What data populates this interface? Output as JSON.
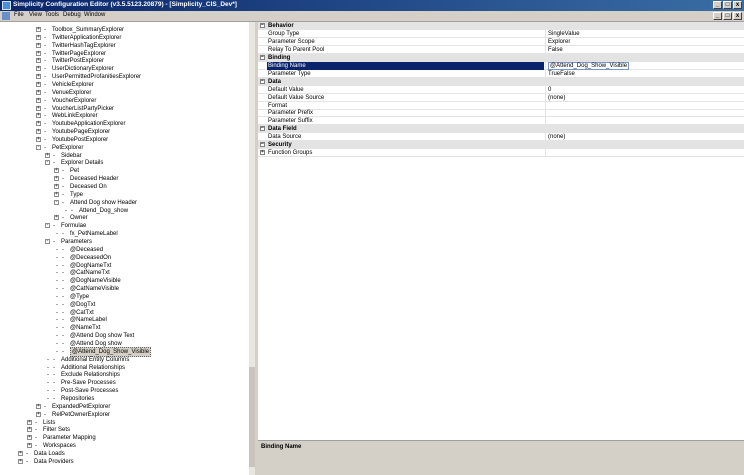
{
  "window": {
    "title": "Simplicity Configuration Editor (v3.5.5123.20879) - [Simplicity_CIS_Dev*]",
    "buttons": [
      "_",
      "□",
      "x"
    ]
  },
  "menu": [
    "File",
    "View",
    "Tools",
    "Debug",
    "Window"
  ],
  "tree": [
    {
      "label": "Toolbox_SummaryExplorer",
      "indent": 0,
      "exp": "+"
    },
    {
      "label": "TwitterApplicationExplorer",
      "indent": 0,
      "exp": "+"
    },
    {
      "label": "TwitterHashTagExplorer",
      "indent": 0,
      "exp": "+"
    },
    {
      "label": "TwitterPageExplorer",
      "indent": 0,
      "exp": "+"
    },
    {
      "label": "TwitterPostExplorer",
      "indent": 0,
      "exp": "+"
    },
    {
      "label": "UserDictionaryExplorer",
      "indent": 0,
      "exp": "+"
    },
    {
      "label": "UserPermittedProfanitiesExplorer",
      "indent": 0,
      "exp": "+"
    },
    {
      "label": "VehicleExplorer",
      "indent": 0,
      "exp": "+"
    },
    {
      "label": "VenueExplorer",
      "indent": 0,
      "exp": "+"
    },
    {
      "label": "VoucherExplorer",
      "indent": 0,
      "exp": "+"
    },
    {
      "label": "VoucherListPartyPicker",
      "indent": 0,
      "exp": "+"
    },
    {
      "label": "WebLinkExplorer",
      "indent": 0,
      "exp": "+"
    },
    {
      "label": "YoutubeApplicationExplorer",
      "indent": 0,
      "exp": "+"
    },
    {
      "label": "YoutubePageExplorer",
      "indent": 0,
      "exp": "+"
    },
    {
      "label": "YoutubePostExplorer",
      "indent": 0,
      "exp": "+"
    },
    {
      "label": "PetExplorer",
      "indent": 0,
      "exp": "-"
    },
    {
      "label": "Sidebar",
      "indent": 1,
      "exp": "+"
    },
    {
      "label": "Explorer Details",
      "indent": 1,
      "exp": "-"
    },
    {
      "label": "Pet",
      "indent": 2,
      "exp": "+"
    },
    {
      "label": "Deceased Header",
      "indent": 2,
      "exp": "+"
    },
    {
      "label": "Deceased On",
      "indent": 2,
      "exp": "+"
    },
    {
      "label": "Type",
      "indent": 2,
      "exp": "+"
    },
    {
      "label": "Attend Dog show Header",
      "indent": 2,
      "exp": "-"
    },
    {
      "label": "Attend_Dog_show",
      "indent": 3,
      "exp": ""
    },
    {
      "label": "Owner",
      "indent": 2,
      "exp": "+"
    },
    {
      "label": "Formulae",
      "indent": 1,
      "exp": "-"
    },
    {
      "label": "fx_PetNameLabel",
      "indent": 2,
      "exp": ""
    },
    {
      "label": "Parameters",
      "indent": 1,
      "exp": "-"
    },
    {
      "label": "@Deceased",
      "indent": 2,
      "exp": ""
    },
    {
      "label": "@DeceasedOn",
      "indent": 2,
      "exp": ""
    },
    {
      "label": "@DogNameTxt",
      "indent": 2,
      "exp": ""
    },
    {
      "label": "@CatNameTxt",
      "indent": 2,
      "exp": ""
    },
    {
      "label": "@DogNameVisible",
      "indent": 2,
      "exp": ""
    },
    {
      "label": "@CatNameVisible",
      "indent": 2,
      "exp": ""
    },
    {
      "label": "@Type",
      "indent": 2,
      "exp": ""
    },
    {
      "label": "@DogTxt",
      "indent": 2,
      "exp": ""
    },
    {
      "label": "@CatTxt",
      "indent": 2,
      "exp": ""
    },
    {
      "label": "@NameLabel",
      "indent": 2,
      "exp": ""
    },
    {
      "label": "@NameTxt",
      "indent": 2,
      "exp": ""
    },
    {
      "label": "@Attend Dog show Text",
      "indent": 2,
      "exp": ""
    },
    {
      "label": "@Attend Dog show",
      "indent": 2,
      "exp": ""
    },
    {
      "label": "@Attend_Dog_Show_Visible",
      "indent": 2,
      "exp": "",
      "selected": true
    },
    {
      "label": "Additional Entity Columns",
      "indent": 1,
      "exp": ""
    },
    {
      "label": "Additional Relationships",
      "indent": 1,
      "exp": ""
    },
    {
      "label": "Exclude Relationships",
      "indent": 1,
      "exp": ""
    },
    {
      "label": "Pre-Save Processes",
      "indent": 1,
      "exp": ""
    },
    {
      "label": "Post-Save Processes",
      "indent": 1,
      "exp": ""
    },
    {
      "label": "Repositories",
      "indent": 1,
      "exp": ""
    },
    {
      "label": "ExpandedPetExplorer",
      "indent": 0,
      "exp": "+"
    },
    {
      "label": "RelPetOwnerExplorer",
      "indent": 0,
      "exp": "+"
    },
    {
      "label": "Lists",
      "indent": -1,
      "exp": "+"
    },
    {
      "label": "Filter Sets",
      "indent": -1,
      "exp": "+"
    },
    {
      "label": "Parameter Mapping",
      "indent": -1,
      "exp": "+"
    },
    {
      "label": "Workspaces",
      "indent": -1,
      "exp": "+"
    },
    {
      "label": "Data Loads",
      "indent": -2,
      "exp": "+"
    },
    {
      "label": "Data Providers",
      "indent": -2,
      "exp": "+"
    }
  ],
  "properties": [
    {
      "type": "cat",
      "name": "Behavior"
    },
    {
      "type": "prop",
      "name": "Group Type",
      "value": "SingleValue"
    },
    {
      "type": "prop",
      "name": "Parameter Scope",
      "value": "Explorer"
    },
    {
      "type": "prop",
      "name": "Relay To Parent Pool",
      "value": "False"
    },
    {
      "type": "cat",
      "name": "Binding"
    },
    {
      "type": "prop",
      "name": "Binding Name",
      "value": "@Attend_Dog_Show_Visible",
      "selected": true
    },
    {
      "type": "prop",
      "name": "Parameter Type",
      "value": "TrueFalse"
    },
    {
      "type": "cat",
      "name": "Data"
    },
    {
      "type": "prop",
      "name": "Default Value",
      "value": "0"
    },
    {
      "type": "prop",
      "name": "Default Value Source",
      "value": "(none)"
    },
    {
      "type": "prop",
      "name": "Format",
      "value": ""
    },
    {
      "type": "prop",
      "name": "Parameter Prefix",
      "value": ""
    },
    {
      "type": "prop",
      "name": "Parameter Suffix",
      "value": ""
    },
    {
      "type": "cat",
      "name": "Data Field"
    },
    {
      "type": "prop",
      "name": "Data Source",
      "value": "(none)"
    },
    {
      "type": "cat",
      "name": "Security"
    },
    {
      "type": "prop",
      "name": "Function Groups",
      "value": "",
      "expandable": true
    }
  ],
  "description": {
    "title": "Binding Name"
  }
}
